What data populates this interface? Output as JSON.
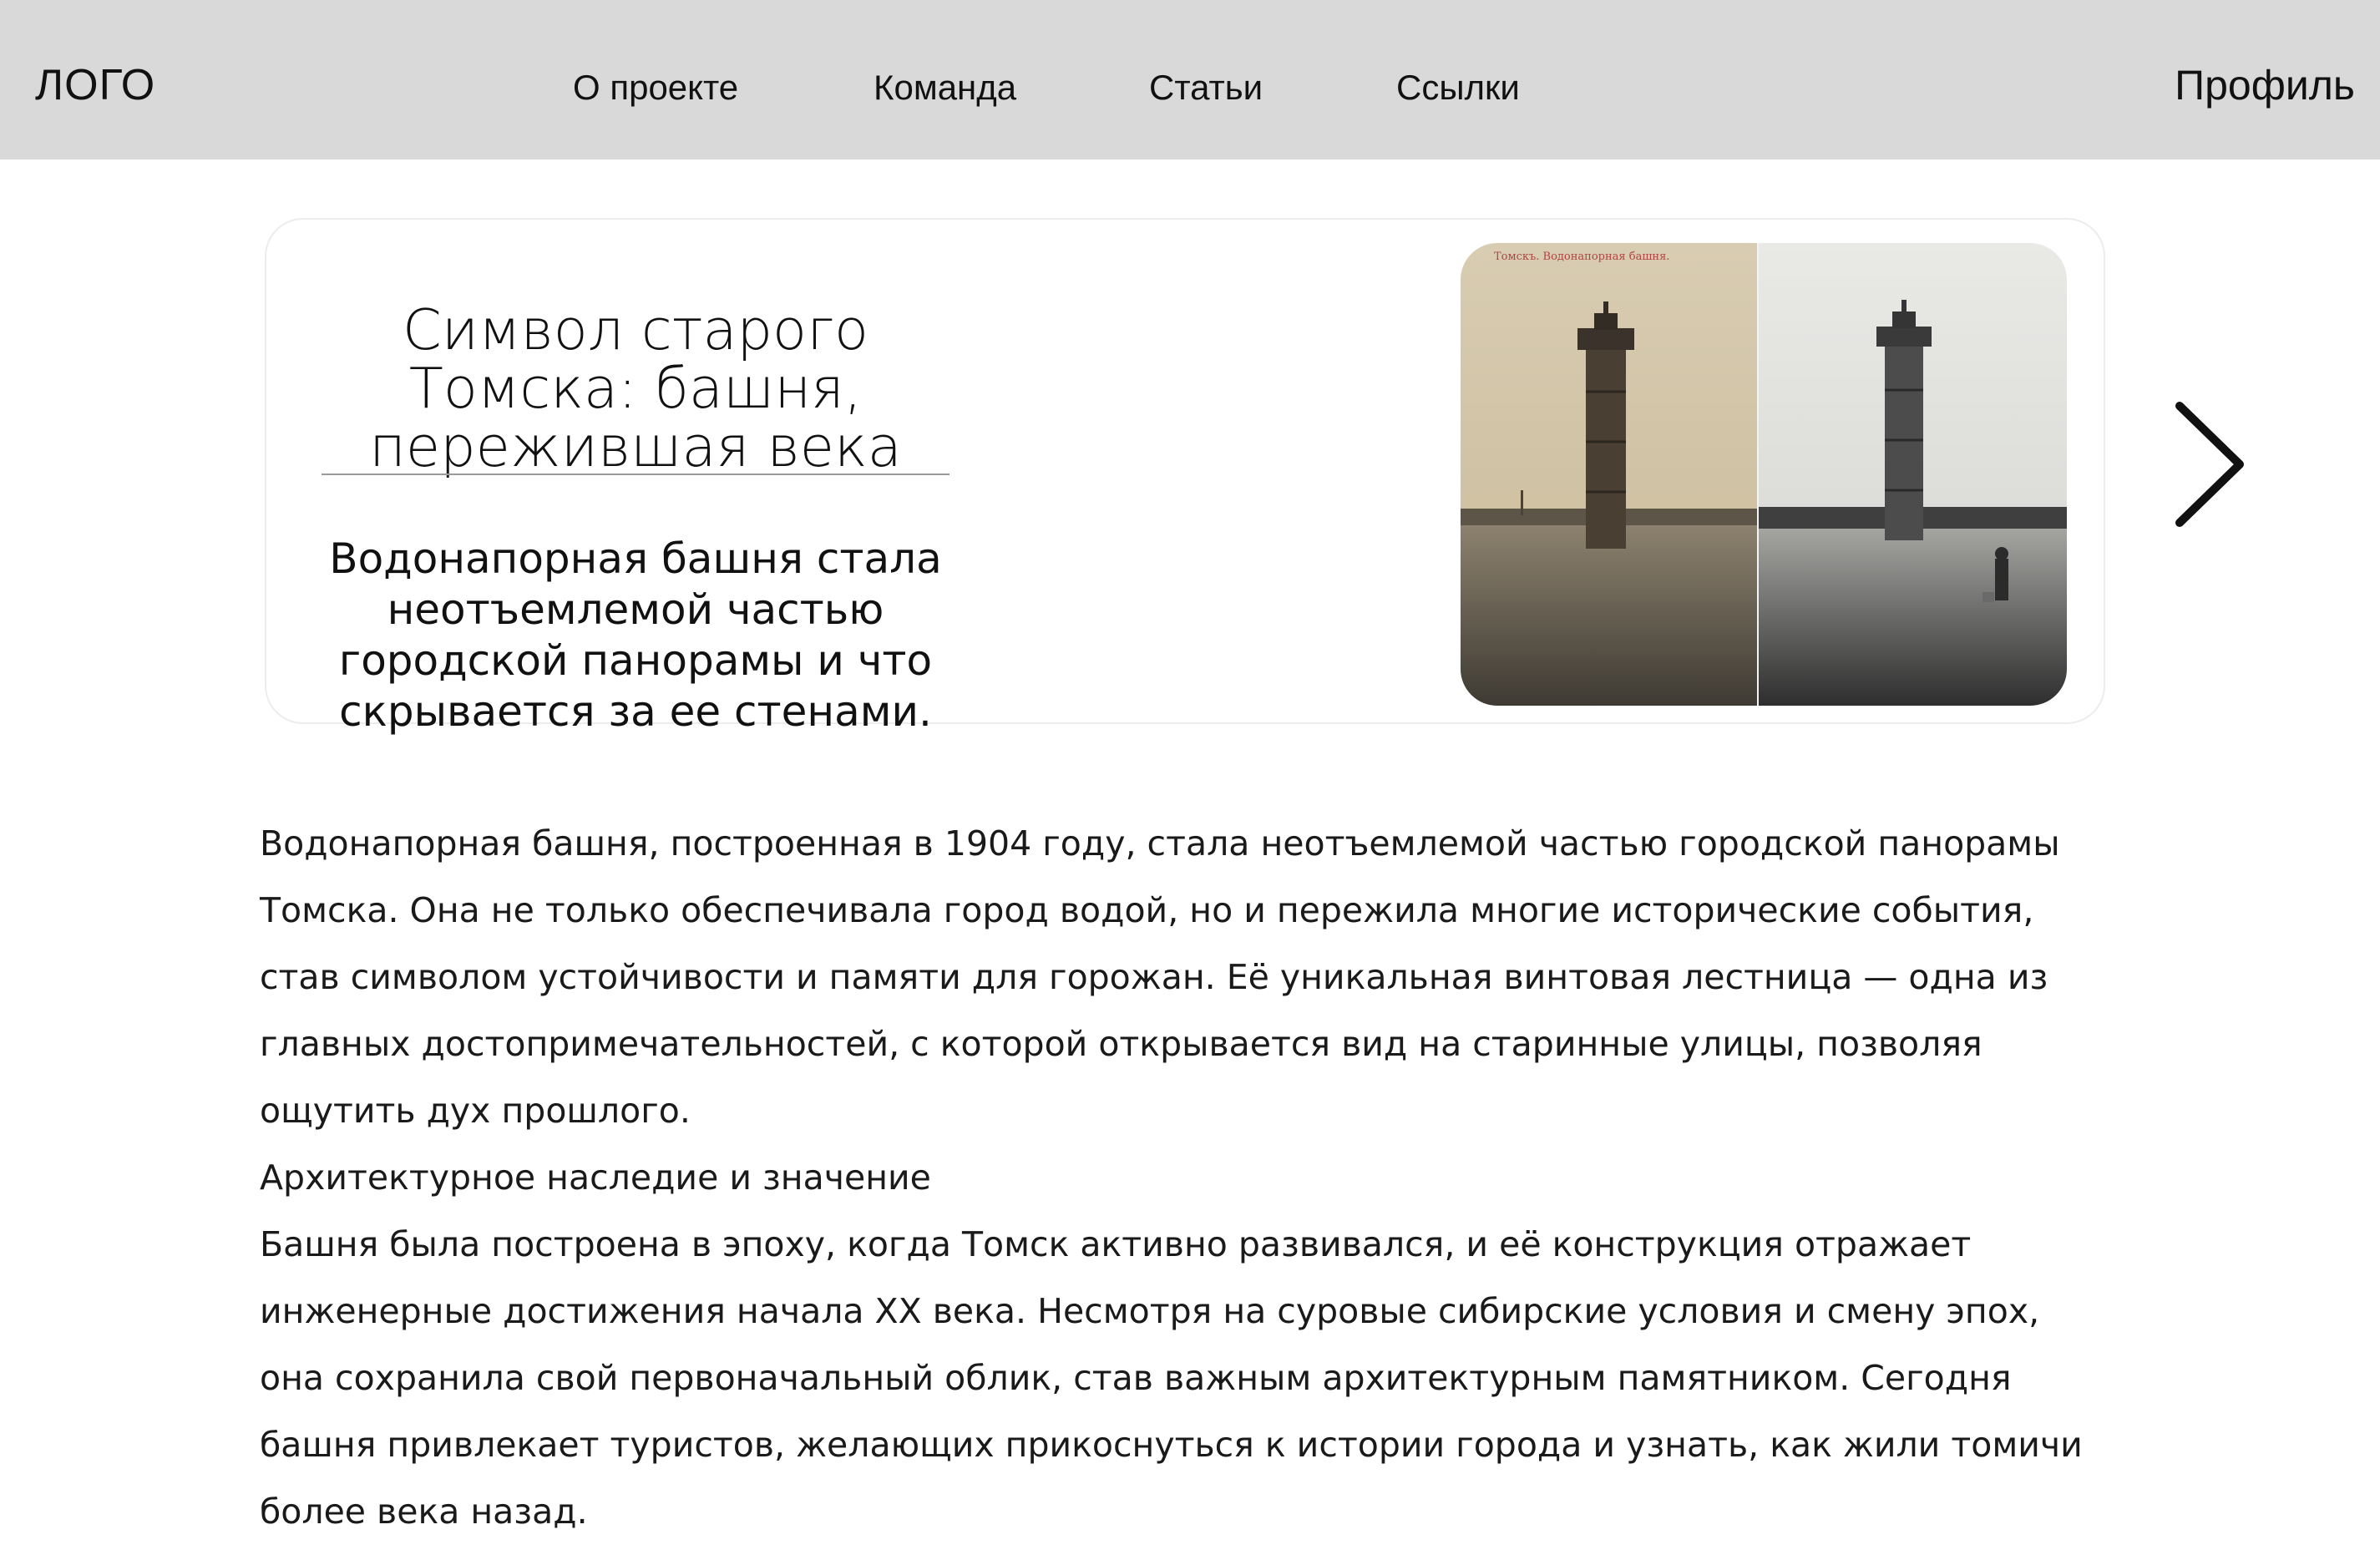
{
  "header": {
    "logo": "ЛОГО",
    "nav": [
      {
        "label": "О проекте"
      },
      {
        "label": "Команда"
      },
      {
        "label": "Статьи"
      },
      {
        "label": "Ссылки"
      }
    ],
    "profile": "Профиль",
    "background_color": "#d9d9d9"
  },
  "hero": {
    "title": "Символ старого Томска: башня, пережившая века",
    "subtitle": "Водонапорная башня стала неотъемлемой частью городской панорамы и что скрывается за ее стенами.",
    "image_caption": "Томскъ. Водонапорная башня.",
    "image_icon": "water-tower-photo",
    "next_icon": "chevron-right-icon"
  },
  "article": {
    "intro": "Водонапорная башня, построенная в 1904 году, стала неотъемлемой частью городской панорамы Томска. Она не только обеспечивала город водой, но и пережила многие исторические события, став символом устойчивости и памяти для горожан. Её уникальная винтовая лестница — одна из главных достопримечательностей, с которой открывается вид на старинные улицы, позволяя ощутить дух прошлого.",
    "section_heading": "Архитектурное наследие и значение",
    "body": "Башня была построена в эпоху, когда Томск активно развивался, и её конструкция отражает инженерные достижения начала XX века. Несмотря на суровые сибирские условия и смену эпох, она сохранила свой первоначальный облик, став важным архитектурным памятником. Сегодня башня привлекает туристов, желающих прикоснуться к истории города и узнать, как жили томичи более века назад."
  }
}
